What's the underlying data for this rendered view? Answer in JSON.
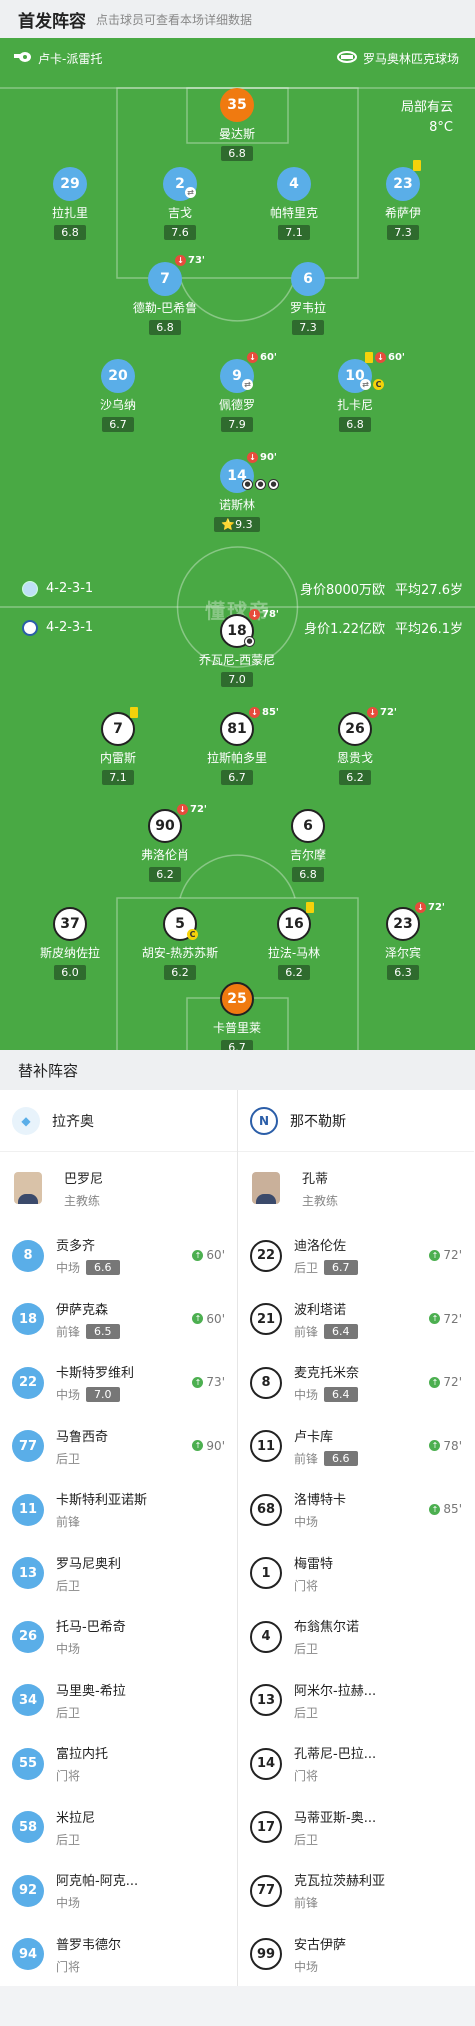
{
  "header": {
    "title": "首发阵容",
    "subtitle": "点击球员可查看本场详细数据"
  },
  "match": {
    "referee": "卢卡-派雷托",
    "venue": "罗马奥林匹克球场",
    "weather": "局部有云",
    "temperature": "8°C",
    "watermark": "懂球帝"
  },
  "home_team": {
    "name": "拉齐奥",
    "formation": "4-2-3-1",
    "value": "身价8000万欧",
    "avg_age": "平均27.6岁",
    "color": "#5aaee8"
  },
  "away_team": {
    "name": "那不勒斯",
    "formation": "4-2-3-1",
    "value": "身价1.22亿欧",
    "avg_age": "平均26.1岁"
  },
  "home_players": [
    {
      "num": "35",
      "name": "曼达斯",
      "rating": "6.8",
      "events": []
    },
    {
      "num": "29",
      "name": "拉扎里",
      "rating": "6.8",
      "events": []
    },
    {
      "num": "2",
      "name": "吉戈",
      "rating": "7.6",
      "events": [
        "swap"
      ]
    },
    {
      "num": "4",
      "name": "帕特里克",
      "rating": "7.1",
      "events": []
    },
    {
      "num": "23",
      "name": "希萨伊",
      "rating": "7.3",
      "events": [
        "yellow"
      ]
    },
    {
      "num": "7",
      "name": "德勒-巴希鲁",
      "rating": "6.8",
      "events": [
        "sub"
      ],
      "minute": "73'"
    },
    {
      "num": "6",
      "name": "罗韦拉",
      "rating": "7.3",
      "events": []
    },
    {
      "num": "20",
      "name": "沙乌纳",
      "rating": "6.7",
      "events": []
    },
    {
      "num": "9",
      "name": "佩德罗",
      "rating": "7.9",
      "events": [
        "sub",
        "swap"
      ],
      "minute": "60'"
    },
    {
      "num": "10",
      "name": "扎卡尼",
      "rating": "6.8",
      "events": [
        "yellow",
        "sub",
        "swap",
        "captain"
      ],
      "minute": "60'"
    },
    {
      "num": "14",
      "name": "诺斯林",
      "rating": "9.3",
      "events": [
        "sub",
        "goals"
      ],
      "minute": "90'",
      "star": "⭐"
    }
  ],
  "away_players": [
    {
      "num": "18",
      "name": "乔瓦尼-西蒙尼",
      "rating": "7.0",
      "events": [
        "sub",
        "ball"
      ],
      "minute": "78'"
    },
    {
      "num": "7",
      "name": "内雷斯",
      "rating": "7.1",
      "events": [
        "yellow"
      ]
    },
    {
      "num": "81",
      "name": "拉斯帕多里",
      "rating": "6.7",
      "events": [
        "sub"
      ],
      "minute": "85'"
    },
    {
      "num": "26",
      "name": "恩贵戈",
      "rating": "6.2",
      "events": [
        "sub"
      ],
      "minute": "72'"
    },
    {
      "num": "90",
      "name": "弗洛伦肖",
      "rating": "6.2",
      "events": [
        "sub"
      ],
      "minute": "72'"
    },
    {
      "num": "6",
      "name": "吉尔摩",
      "rating": "6.8",
      "events": []
    },
    {
      "num": "37",
      "name": "斯皮纳佐拉",
      "rating": "6.0",
      "events": []
    },
    {
      "num": "5",
      "name": "胡安-热苏苏斯",
      "rating": "6.2",
      "events": [
        "captain"
      ]
    },
    {
      "num": "16",
      "name": "拉法-马林",
      "rating": "6.2",
      "events": [
        "yellow"
      ]
    },
    {
      "num": "23",
      "name": "泽尔宾",
      "rating": "6.3",
      "events": [
        "sub"
      ],
      "minute": "72'"
    },
    {
      "num": "25",
      "name": "卡普里莱",
      "rating": "6.7",
      "events": []
    }
  ],
  "subs_section": {
    "title": "替补阵容"
  },
  "home_coach": {
    "name": "巴罗尼",
    "role": "主教练"
  },
  "away_coach": {
    "name": "孔蒂",
    "role": "主教练"
  },
  "home_subs": [
    {
      "num": "8",
      "name": "贡多齐",
      "pos": "中场",
      "rating": "6.6",
      "sub_in": "60'"
    },
    {
      "num": "18",
      "name": "伊萨克森",
      "pos": "前锋",
      "rating": "6.5",
      "sub_in": "60'"
    },
    {
      "num": "22",
      "name": "卡斯特罗维利",
      "pos": "中场",
      "rating": "7.0",
      "sub_in": "73'"
    },
    {
      "num": "77",
      "name": "马鲁西奇",
      "pos": "后卫",
      "rating": "",
      "sub_in": "90'"
    },
    {
      "num": "11",
      "name": "卡斯特利亚诺斯",
      "pos": "前锋",
      "rating": "",
      "sub_in": ""
    },
    {
      "num": "13",
      "name": "罗马尼奥利",
      "pos": "后卫",
      "rating": "",
      "sub_in": ""
    },
    {
      "num": "26",
      "name": "托马-巴希奇",
      "pos": "中场",
      "rating": "",
      "sub_in": ""
    },
    {
      "num": "34",
      "name": "马里奥-希拉",
      "pos": "后卫",
      "rating": "",
      "sub_in": ""
    },
    {
      "num": "55",
      "name": "富拉内托",
      "pos": "门将",
      "rating": "",
      "sub_in": ""
    },
    {
      "num": "58",
      "name": "米拉尼",
      "pos": "后卫",
      "rating": "",
      "sub_in": ""
    },
    {
      "num": "92",
      "name": "阿克帕-阿克...",
      "pos": "中场",
      "rating": "",
      "sub_in": ""
    },
    {
      "num": "94",
      "name": "普罗韦德尔",
      "pos": "门将",
      "rating": "",
      "sub_in": ""
    }
  ],
  "away_subs": [
    {
      "num": "22",
      "name": "迪洛伦佐",
      "pos": "后卫",
      "rating": "6.7",
      "sub_in": "72'"
    },
    {
      "num": "21",
      "name": "波利塔诺",
      "pos": "前锋",
      "rating": "6.4",
      "sub_in": "72'"
    },
    {
      "num": "8",
      "name": "麦克托米奈",
      "pos": "中场",
      "rating": "6.4",
      "sub_in": "72'"
    },
    {
      "num": "11",
      "name": "卢卡库",
      "pos": "前锋",
      "rating": "6.6",
      "sub_in": "78'"
    },
    {
      "num": "68",
      "name": "洛博特卡",
      "pos": "中场",
      "rating": "",
      "sub_in": "85'"
    },
    {
      "num": "1",
      "name": "梅雷特",
      "pos": "门将",
      "rating": "",
      "sub_in": ""
    },
    {
      "num": "4",
      "name": "布翁焦尔诺",
      "pos": "后卫",
      "rating": "",
      "sub_in": ""
    },
    {
      "num": "13",
      "name": "阿米尔-拉赫...",
      "pos": "后卫",
      "rating": "",
      "sub_in": ""
    },
    {
      "num": "14",
      "name": "孔蒂尼-巴拉...",
      "pos": "门将",
      "rating": "",
      "sub_in": ""
    },
    {
      "num": "17",
      "name": "马蒂亚斯-奥...",
      "pos": "后卫",
      "rating": "",
      "sub_in": ""
    },
    {
      "num": "77",
      "name": "克瓦拉茨赫利亚",
      "pos": "前锋",
      "rating": "",
      "sub_in": ""
    },
    {
      "num": "99",
      "name": "安古伊萨",
      "pos": "中场",
      "rating": "",
      "sub_in": ""
    }
  ]
}
